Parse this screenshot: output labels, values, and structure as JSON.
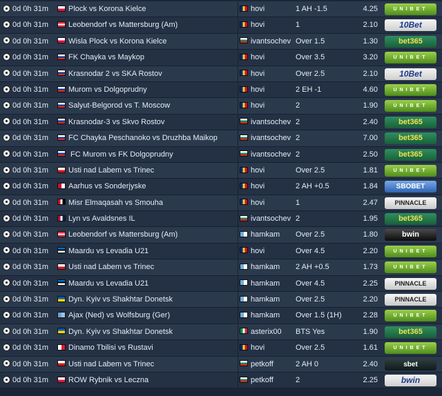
{
  "flag_colors": {
    "pl": [
      "#ffffff",
      "#dc143c"
    ],
    "ru": [
      "#ffffff",
      "#0039a6",
      "#d52b1e"
    ],
    "at": [
      "#ed2939",
      "#ffffff",
      "#ed2939"
    ],
    "cz": [
      "#ffffff",
      "#d7141a"
    ],
    "dk": [
      "#c60c30",
      "#ffffff"
    ],
    "eg": [
      "#ce1126",
      "#ffffff",
      "#000000"
    ],
    "no": [
      "#ba0c2f",
      "#ffffff",
      "#00205b"
    ],
    "ee": [
      "#0072ce",
      "#000000",
      "#ffffff"
    ],
    "ua": [
      "#0057b7",
      "#ffd700"
    ],
    "eu": [
      "#6fa3d8",
      "#9bc4ea"
    ],
    "ge": [
      "#ffffff",
      "#e31b23"
    ],
    "ro": [
      "#002b7f",
      "#fcd116",
      "#ce1126"
    ],
    "bg": [
      "#ffffff",
      "#00966e",
      "#d62612"
    ],
    "ar": [
      "#74acdf",
      "#ffffff"
    ],
    "it": [
      "#009246",
      "#ffffff",
      "#ce2b37"
    ]
  },
  "rows": [
    {
      "time": "0d 0h 31m",
      "match": "Plock vs Korona Kielce",
      "match_flag": "pl",
      "user": "hovi",
      "user_flag": "ro",
      "pick": "1 AH -1.5",
      "odds": "4.25",
      "bookmaker": "UNIBET",
      "book_style": "unibet"
    },
    {
      "time": "0d 0h 31m",
      "match": "Leobendorf vs Mattersburg (Am)",
      "match_flag": "at",
      "user": "hovi",
      "user_flag": "ro",
      "pick": "1",
      "odds": "2.10",
      "bookmaker": "10Bet",
      "book_style": "tenbet"
    },
    {
      "time": "0d 0h 31m",
      "match": "Wisla Plock vs Korona Kielce",
      "match_flag": "pl",
      "user": "ivantsochev",
      "user_flag": "bg",
      "pick": "Over 1.5",
      "odds": "1.30",
      "bookmaker": "bet365",
      "book_style": "bet365"
    },
    {
      "time": "0d 0h 31m",
      "match": "FK Chayka vs Maykop",
      "match_flag": "ru",
      "user": "hovi",
      "user_flag": "ro",
      "pick": "Over 3.5",
      "odds": "3.20",
      "bookmaker": "UNIBET",
      "book_style": "unibet"
    },
    {
      "time": "0d 0h 31m",
      "match": "Krasnodar 2 vs SKA Rostov",
      "match_flag": "ru",
      "user": "hovi",
      "user_flag": "ro",
      "pick": "Over 2.5",
      "odds": "2.10",
      "bookmaker": "10Bet",
      "book_style": "tenbet"
    },
    {
      "time": "0d 0h 31m",
      "match": "Murom vs Dolgoprudny",
      "match_flag": "ru",
      "user": "hovi",
      "user_flag": "ro",
      "pick": "2 EH -1",
      "odds": "4.60",
      "bookmaker": "UNIBET",
      "book_style": "unibet"
    },
    {
      "time": "0d 0h 31m",
      "match": "Salyut-Belgorod vs T. Moscow",
      "match_flag": "ru",
      "user": "hovi",
      "user_flag": "ro",
      "pick": "2",
      "odds": "1.90",
      "bookmaker": "UNIBET",
      "book_style": "unibet"
    },
    {
      "time": "0d 0h 31m",
      "match": "Krasnodar-3 vs Skvo Rostov",
      "match_flag": "ru",
      "user": "ivantsochev",
      "user_flag": "bg",
      "pick": "2",
      "odds": "2.40",
      "bookmaker": "bet365",
      "book_style": "bet365"
    },
    {
      "time": "0d 0h 31m",
      "match": "FC Chayka Peschanoko vs Druzhba Maikop",
      "match_flag": "ru",
      "user": "ivantsochev",
      "user_flag": "bg",
      "pick": "2",
      "odds": "7.00",
      "bookmaker": "bet365",
      "book_style": "bet365"
    },
    {
      "time": "0d 0h 31m",
      "match": " FC Murom vs FK Dolgoprudny",
      "match_flag": "ru",
      "user": "ivantsochev",
      "user_flag": "bg",
      "pick": "2",
      "odds": "2.50",
      "bookmaker": "bet365",
      "book_style": "bet365"
    },
    {
      "time": "0d 0h 31m",
      "match": "Usti nad Labem vs Trinec",
      "match_flag": "cz",
      "user": "hovi",
      "user_flag": "ro",
      "pick": "Over 2.5",
      "odds": "1.81",
      "bookmaker": "UNIBET",
      "book_style": "unibet"
    },
    {
      "time": "0d 0h 31m",
      "match": "Aarhus vs Sonderjyske",
      "match_flag": "dk",
      "user": "hovi",
      "user_flag": "ro",
      "pick": "2 AH +0.5",
      "odds": "1.84",
      "bookmaker": "SBOBET",
      "book_style": "sbobet"
    },
    {
      "time": "0d 0h 31m",
      "match": "Misr Elmaqasah vs Smouha",
      "match_flag": "eg",
      "user": "hovi",
      "user_flag": "ro",
      "pick": "1",
      "odds": "2.47",
      "bookmaker": "PINNACLE",
      "book_style": "pinnacle"
    },
    {
      "time": "0d 0h 31m",
      "match": "Lyn vs Avaldsnes IL",
      "match_flag": "no",
      "user": "ivantsochev",
      "user_flag": "bg",
      "pick": "2",
      "odds": "1.95",
      "bookmaker": "bet365",
      "book_style": "bet365"
    },
    {
      "time": "0d 0h 31m",
      "match": "Leobendorf vs Mattersburg (Am)",
      "match_flag": "at",
      "user": "hamkam",
      "user_flag": "ar",
      "pick": "Over 2.5",
      "odds": "1.80",
      "bookmaker": "bwin",
      "book_style": "bwin"
    },
    {
      "time": "0d 0h 31m",
      "match": "Maardu vs Levadia U21",
      "match_flag": "ee",
      "user": "hovi",
      "user_flag": "ro",
      "pick": "Over 4.5",
      "odds": "2.20",
      "bookmaker": "UNIBET",
      "book_style": "unibet"
    },
    {
      "time": "0d 0h 31m",
      "match": "Usti nad Labem vs Trinec",
      "match_flag": "cz",
      "user": "hamkam",
      "user_flag": "ar",
      "pick": "2 AH +0.5",
      "odds": "1.73",
      "bookmaker": "UNIBET",
      "book_style": "unibet"
    },
    {
      "time": "0d 0h 31m",
      "match": "Maardu vs Levadia U21",
      "match_flag": "ee",
      "user": "hamkam",
      "user_flag": "ar",
      "pick": "Over 4.5",
      "odds": "2.25",
      "bookmaker": "PINNACLE",
      "book_style": "pinnacle"
    },
    {
      "time": "0d 0h 31m",
      "match": "Dyn. Kyiv vs Shakhtar Donetsk",
      "match_flag": "ua",
      "user": "hamkam",
      "user_flag": "ar",
      "pick": "Over 2.5",
      "odds": "2.20",
      "bookmaker": "PINNACLE",
      "book_style": "pinnacle"
    },
    {
      "time": "0d 0h 31m",
      "match": "Ajax (Ned) vs Wolfsburg (Ger)",
      "match_flag": "eu",
      "user": "hamkam",
      "user_flag": "ar",
      "pick": "Over 1.5 (1H)",
      "odds": "2.28",
      "bookmaker": "UNIBET",
      "book_style": "unibet"
    },
    {
      "time": "0d 0h 31m",
      "match": "Dyn. Kyiv vs Shakhtar Donetsk",
      "match_flag": "ua",
      "user": "asterix00",
      "user_flag": "it",
      "pick": "BTS Yes",
      "odds": "1.90",
      "bookmaker": "bet365",
      "book_style": "bet365"
    },
    {
      "time": "0d 0h 31m",
      "match": "Dinamo Tbilisi vs Rustavi",
      "match_flag": "ge",
      "user": "hovi",
      "user_flag": "ro",
      "pick": "Over 2.5",
      "odds": "1.61",
      "bookmaker": "UNIBET",
      "book_style": "unibet"
    },
    {
      "time": "0d 0h 31m",
      "match": "Usti nad Labem vs Trinec",
      "match_flag": "cz",
      "user": "petkoff",
      "user_flag": "bg",
      "pick": "2 AH 0",
      "odds": "2.40",
      "bookmaker": "sbet",
      "book_style": "sfoo"
    },
    {
      "time": "0d 0h 31m",
      "match": "ROW Rybnik vs Leczna",
      "match_flag": "pl",
      "user": "petkoff",
      "user_flag": "bg",
      "pick": "2",
      "odds": "2.25",
      "bookmaker": "bwin",
      "book_style": "tenbet"
    }
  ]
}
